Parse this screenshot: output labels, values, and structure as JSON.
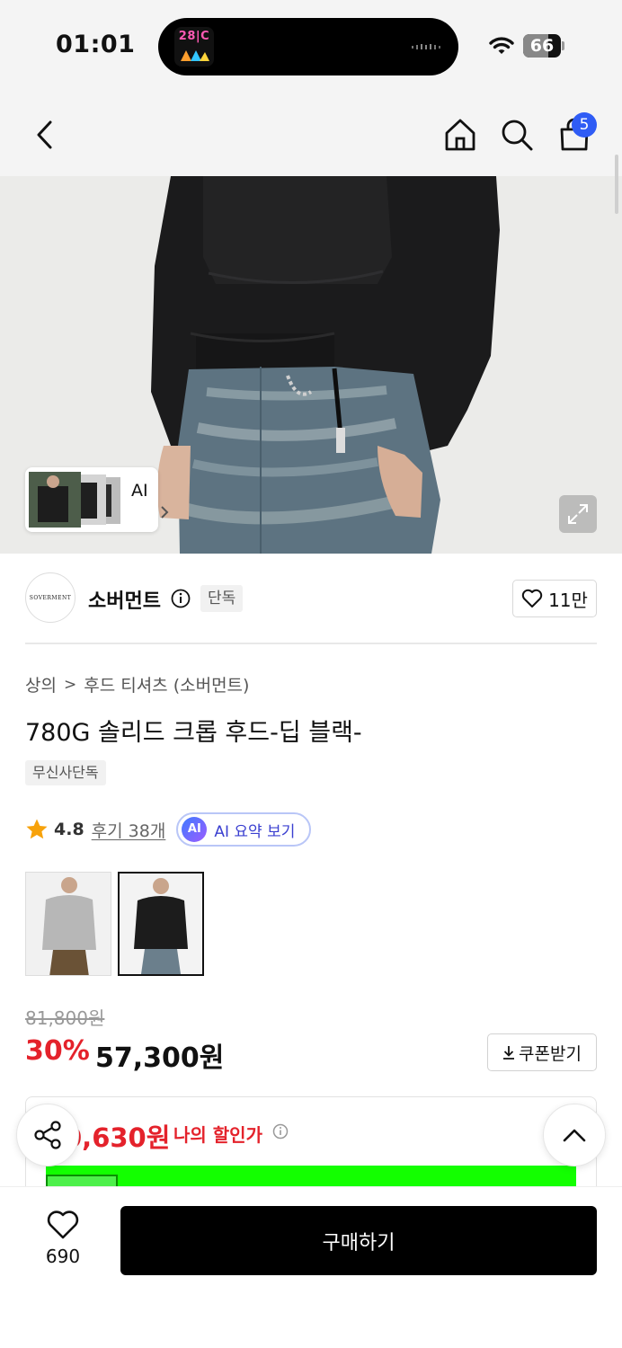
{
  "status_bar": {
    "time": "01:01",
    "battery": "66",
    "battery_level": 0.66,
    "island_app_label": "28|C"
  },
  "nav": {
    "back_icon": "chevron-left-icon",
    "home_icon": "home-icon",
    "search_icon": "search-icon",
    "cart_icon": "shopping-bag-icon",
    "cart_count": "5"
  },
  "hero": {
    "ai_label": "AI"
  },
  "brand": {
    "logo_text": "SOVERMENT",
    "name": "소버먼트",
    "exclusive_badge": "단독",
    "like_count": "11만"
  },
  "product": {
    "breadcrumb": [
      "상의",
      "후드 티셔츠 (소버먼트)"
    ],
    "title": "780G 솔리드 크롭 후드-딥 블랙-",
    "tag": "무신사단독",
    "rating": "4.8",
    "reviews": "후기 38개",
    "ai_summary_badge": "AI",
    "ai_summary": "AI 요약 보기"
  },
  "price": {
    "original": "81,800원",
    "discount": "30%",
    "sale": "57,300원",
    "coupon": "쿠폰받기",
    "my_price": "0,630원",
    "my_price_label": "나의 할인가"
  },
  "bottom": {
    "wish_count": "690",
    "buy_label": "구매하기"
  },
  "colors": {
    "accent_red": "#e4222b",
    "badge_blue": "#2f5cf5",
    "banner_green": "#13ff00"
  }
}
